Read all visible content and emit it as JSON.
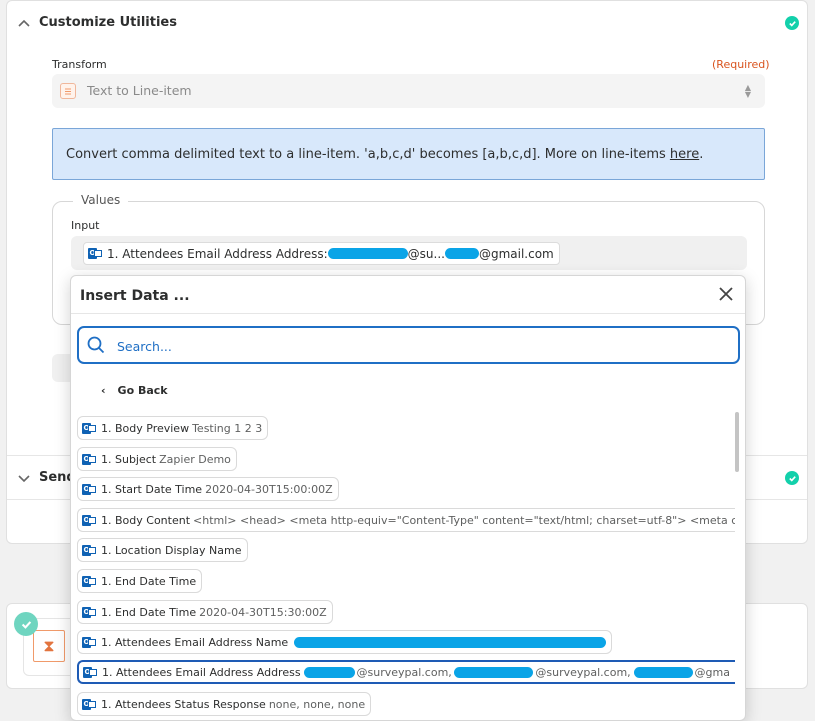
{
  "customize": {
    "title": "Customize Utilities",
    "transform_label": "Transform",
    "required_label": "(Required)",
    "transform_value": "Text to Line-item",
    "info_text": "Convert comma delimited text to a line-item. 'a,b,c,d' becomes [a,b,c,d]. More on line-items ",
    "info_link": "here",
    "info_end": ".",
    "values_legend": "Values",
    "input_label": "Input",
    "input_chip": {
      "key": "1. Attendees Email Address Address:",
      "mid": "@su...",
      "end": "@gmail.com"
    }
  },
  "send": {
    "title": "Send"
  },
  "colors": {
    "accent": "#1f6fc5",
    "success": "#13d0ab",
    "mask": "#0aa4e7",
    "outlook": "#0f62b4"
  },
  "popup": {
    "title": "Insert Data ...",
    "search_placeholder": "Search...",
    "go_back": "Go Back",
    "rows": [
      {
        "key": "1. Body Preview",
        "value": "Testing 1 2 3"
      },
      {
        "key": "1. Subject",
        "value": "Zapier Demo"
      },
      {
        "key": "1. Start Date Time",
        "value": "2020-04-30T15:00:00Z"
      },
      {
        "key": "1. Body Content",
        "value": "<html> <head> <meta http-equiv=\"Content-Type\" content=\"text/html; charset=utf-8\"> <meta content=\"text/h"
      },
      {
        "key": "1. Location Display Name",
        "value": ""
      },
      {
        "key": "1. End Date Time",
        "value": ""
      },
      {
        "key": "1. End Date Time",
        "value": "2020-04-30T15:30:00Z"
      },
      {
        "key": "1. Attendees Email Address Name",
        "value": ""
      },
      {
        "key": "1. Attendees Email Address Address",
        "value_parts": [
          "@surveypal.com,",
          "@surveypal.com,",
          "@gma"
        ]
      },
      {
        "key": "1. Attendees Status Response",
        "value": "none, none, none"
      }
    ]
  }
}
